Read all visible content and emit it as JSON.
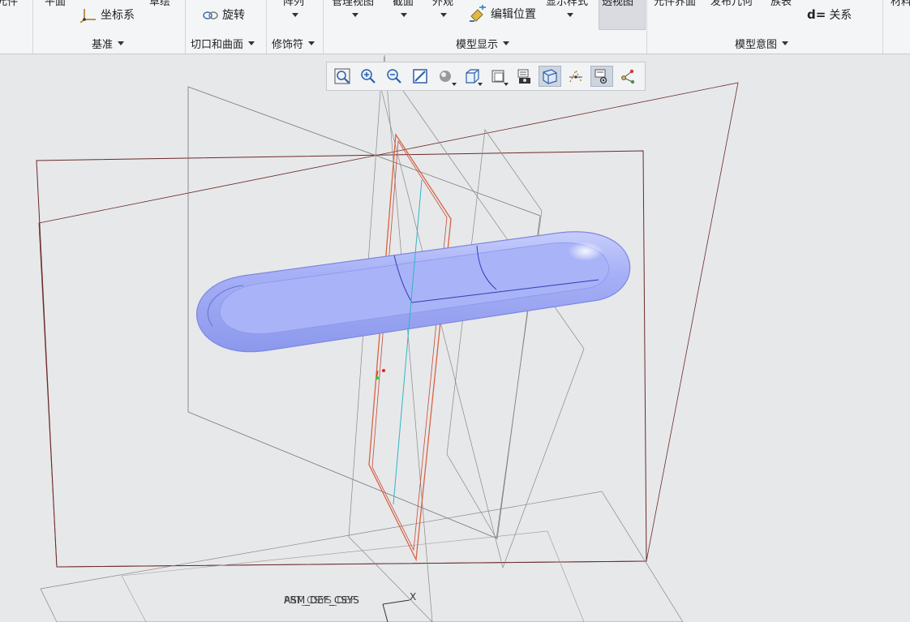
{
  "ribbon": {
    "cut_top_labels": [
      "元件",
      "平面",
      "草绘",
      "阵列",
      "管理视图",
      "截面",
      "外观",
      "显示样式",
      "透视图",
      "元件界面",
      "发布几何",
      "族表",
      "材料"
    ],
    "datum": {
      "csys_label": "坐标系",
      "title": "基准"
    },
    "cuts": {
      "revolve_label": "旋转",
      "title": "切口和曲面"
    },
    "decorators": {
      "title": "修饰符"
    },
    "model_display": {
      "edit_position_label": "编辑位置",
      "title": "模型显示"
    },
    "model_intent": {
      "relations_label": "关系",
      "relations_prefix": "d=",
      "title": "模型意图"
    }
  },
  "graphics_toolbar": {
    "buttons": [
      {
        "icon": "refit-icon"
      },
      {
        "icon": "zoom-in-icon"
      },
      {
        "icon": "zoom-out-icon"
      },
      {
        "icon": "repaint-icon"
      },
      {
        "icon": "display-style-icon"
      },
      {
        "icon": "saved-views-icon"
      },
      {
        "icon": "view-manager-icon"
      },
      {
        "icon": "annotation-display-icon"
      },
      {
        "icon": "perspective-icon",
        "active": true
      },
      {
        "icon": "datum-display-icon"
      },
      {
        "icon": "spin-center-icon",
        "active": true
      },
      {
        "icon": "csys-display-icon"
      }
    ]
  },
  "viewport": {
    "csys_name": "ASM_DEF_CSYS",
    "csys_overlap_text": "PRT_CSYS_DEF",
    "axis_x_label": "X"
  },
  "colors": {
    "part_fill": "#9aa6f2",
    "selected_plane": "#d9633f",
    "datum_plane": "#6b2a2a",
    "sketch_line": "#2fb5c4"
  }
}
